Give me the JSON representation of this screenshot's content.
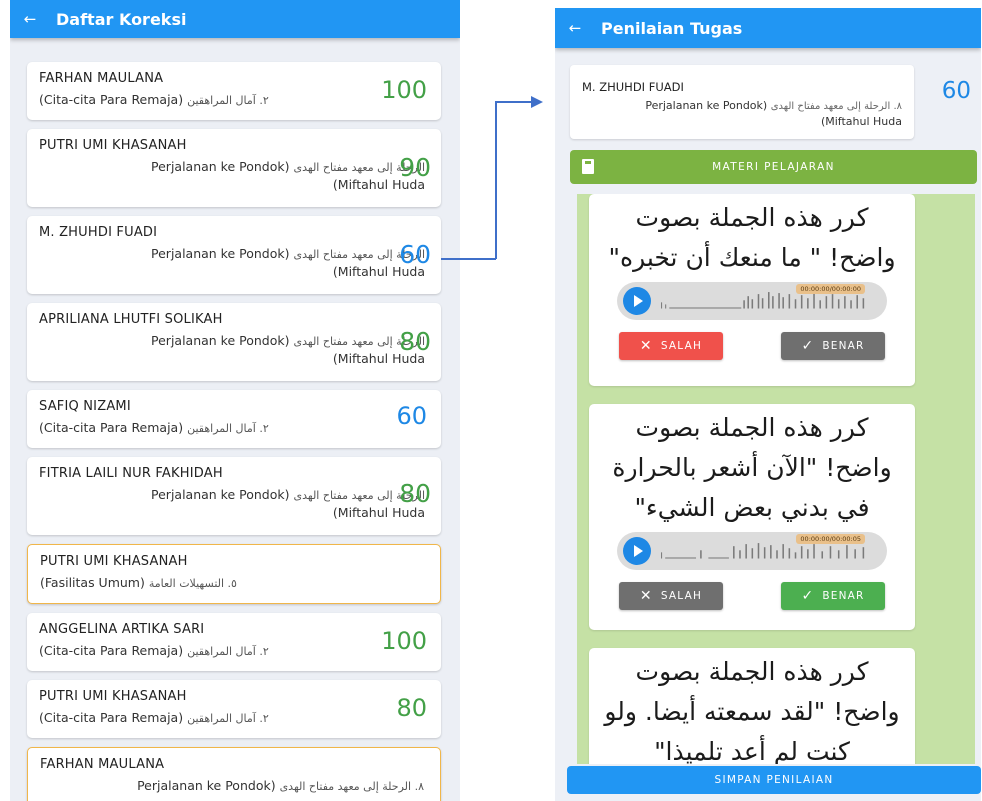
{
  "left": {
    "title": "Daftar Koreksi",
    "back_glyph": "←",
    "cards": [
      {
        "name": "FARHAN MAULANA",
        "sub_latin": "(Cita-cita Para Remaja)",
        "sub_arabic": "٢. آمال المراهقين",
        "score": "100",
        "score_color": "#43a047"
      },
      {
        "name": "PUTRI UMI KHASANAH",
        "sub_latin": "Perjalanan ke Pondok)",
        "sub_arabic": "الرحلة إلى معهد مفتاح الهدى",
        "sub_line2": "(Miftahul Huda",
        "score": "90",
        "score_color": "#43a047"
      },
      {
        "name": "M. ZHUHDI FUADI",
        "sub_latin": "Perjalanan ke Pondok)",
        "sub_arabic": "الرحلة إلى معهد مفتاح الهدى",
        "sub_line2": "(Miftahul Huda",
        "score": "60",
        "score_color": "#1e88e5"
      },
      {
        "name": "APRILIANA LHUTFI SOLIKAH",
        "sub_latin": "Perjalanan ke Pondok)",
        "sub_arabic": "الرحلة إلى معهد مفتاح الهدى",
        "sub_line2": "(Miftahul Huda",
        "score": "80",
        "score_color": "#43a047"
      },
      {
        "name": "SAFIQ NIZAMI",
        "sub_latin": "(Cita-cita Para Remaja)",
        "sub_arabic": "٢. آمال المراهقين",
        "score": "60",
        "score_color": "#1e88e5"
      },
      {
        "name": "FITRIA LAILI NUR FAKHIDAH",
        "sub_latin": "Perjalanan ke Pondok)",
        "sub_arabic": "الرحلة إلى معهد مفتاح الهدى",
        "sub_line2": "(Miftahul Huda",
        "score": "80",
        "score_color": "#43a047"
      },
      {
        "name": "PUTRI UMI KHASANAH",
        "sub_latin": "(Fasilitas Umum)",
        "sub_arabic": "٥. التسهيلات العامة",
        "score": "",
        "score_color": "#43a047",
        "selected": true
      },
      {
        "name": "ANGGELINA ARTIKA SARI",
        "sub_latin": "(Cita-cita Para Remaja)",
        "sub_arabic": "٢. آمال المراهقين",
        "score": "100",
        "score_color": "#43a047"
      },
      {
        "name": "PUTRI UMI KHASANAH",
        "sub_latin": "(Cita-cita Para Remaja)",
        "sub_arabic": "٢. آمال المراهقين",
        "score": "80",
        "score_color": "#43a047"
      },
      {
        "name": "FARHAN MAULANA",
        "sub_latin": "Perjalanan ke Pondok)",
        "sub_arabic": "٨. الرحلة إلى معهد مفتاح الهدى",
        "score": "",
        "score_color": "#43a047",
        "selected": true
      }
    ]
  },
  "right": {
    "title": "Penilaian Tugas",
    "back_glyph": "←",
    "student": {
      "name": "M. ZHUHDI FUADI",
      "sub_latin": "Perjalanan ke Pondok)",
      "sub_arabic": "٨. الرحلة إلى معهد مفتاح الهدى",
      "sub_line2": "(Miftahul Huda",
      "score": "60"
    },
    "materi_label": "MATERI PELAJARAN",
    "questions": [
      {
        "text": "كرر هذه الجملة بصوت واضح! \" ما منعك أن تخبره\"",
        "time": "00:00:00/00:00:00",
        "salah": "SALAH",
        "benar": "BENAR",
        "selected": "salah"
      },
      {
        "text": "كرر هذه الجملة بصوت واضح! \"الآن أشعر بالحرارة في بدني بعض الشيء\"",
        "time": "00:00:00/00:00:05",
        "salah": "SALAH",
        "benar": "BENAR",
        "selected": "benar"
      },
      {
        "text": "كرر هذه الجملة بصوت واضح! \"لقد سمعته أيضا. ولو كنت لم أعد تلميذا\""
      }
    ],
    "salah_glyph": "✕",
    "benar_glyph": "✓",
    "simpan_label": "SIMPAN PENILAIAN"
  }
}
